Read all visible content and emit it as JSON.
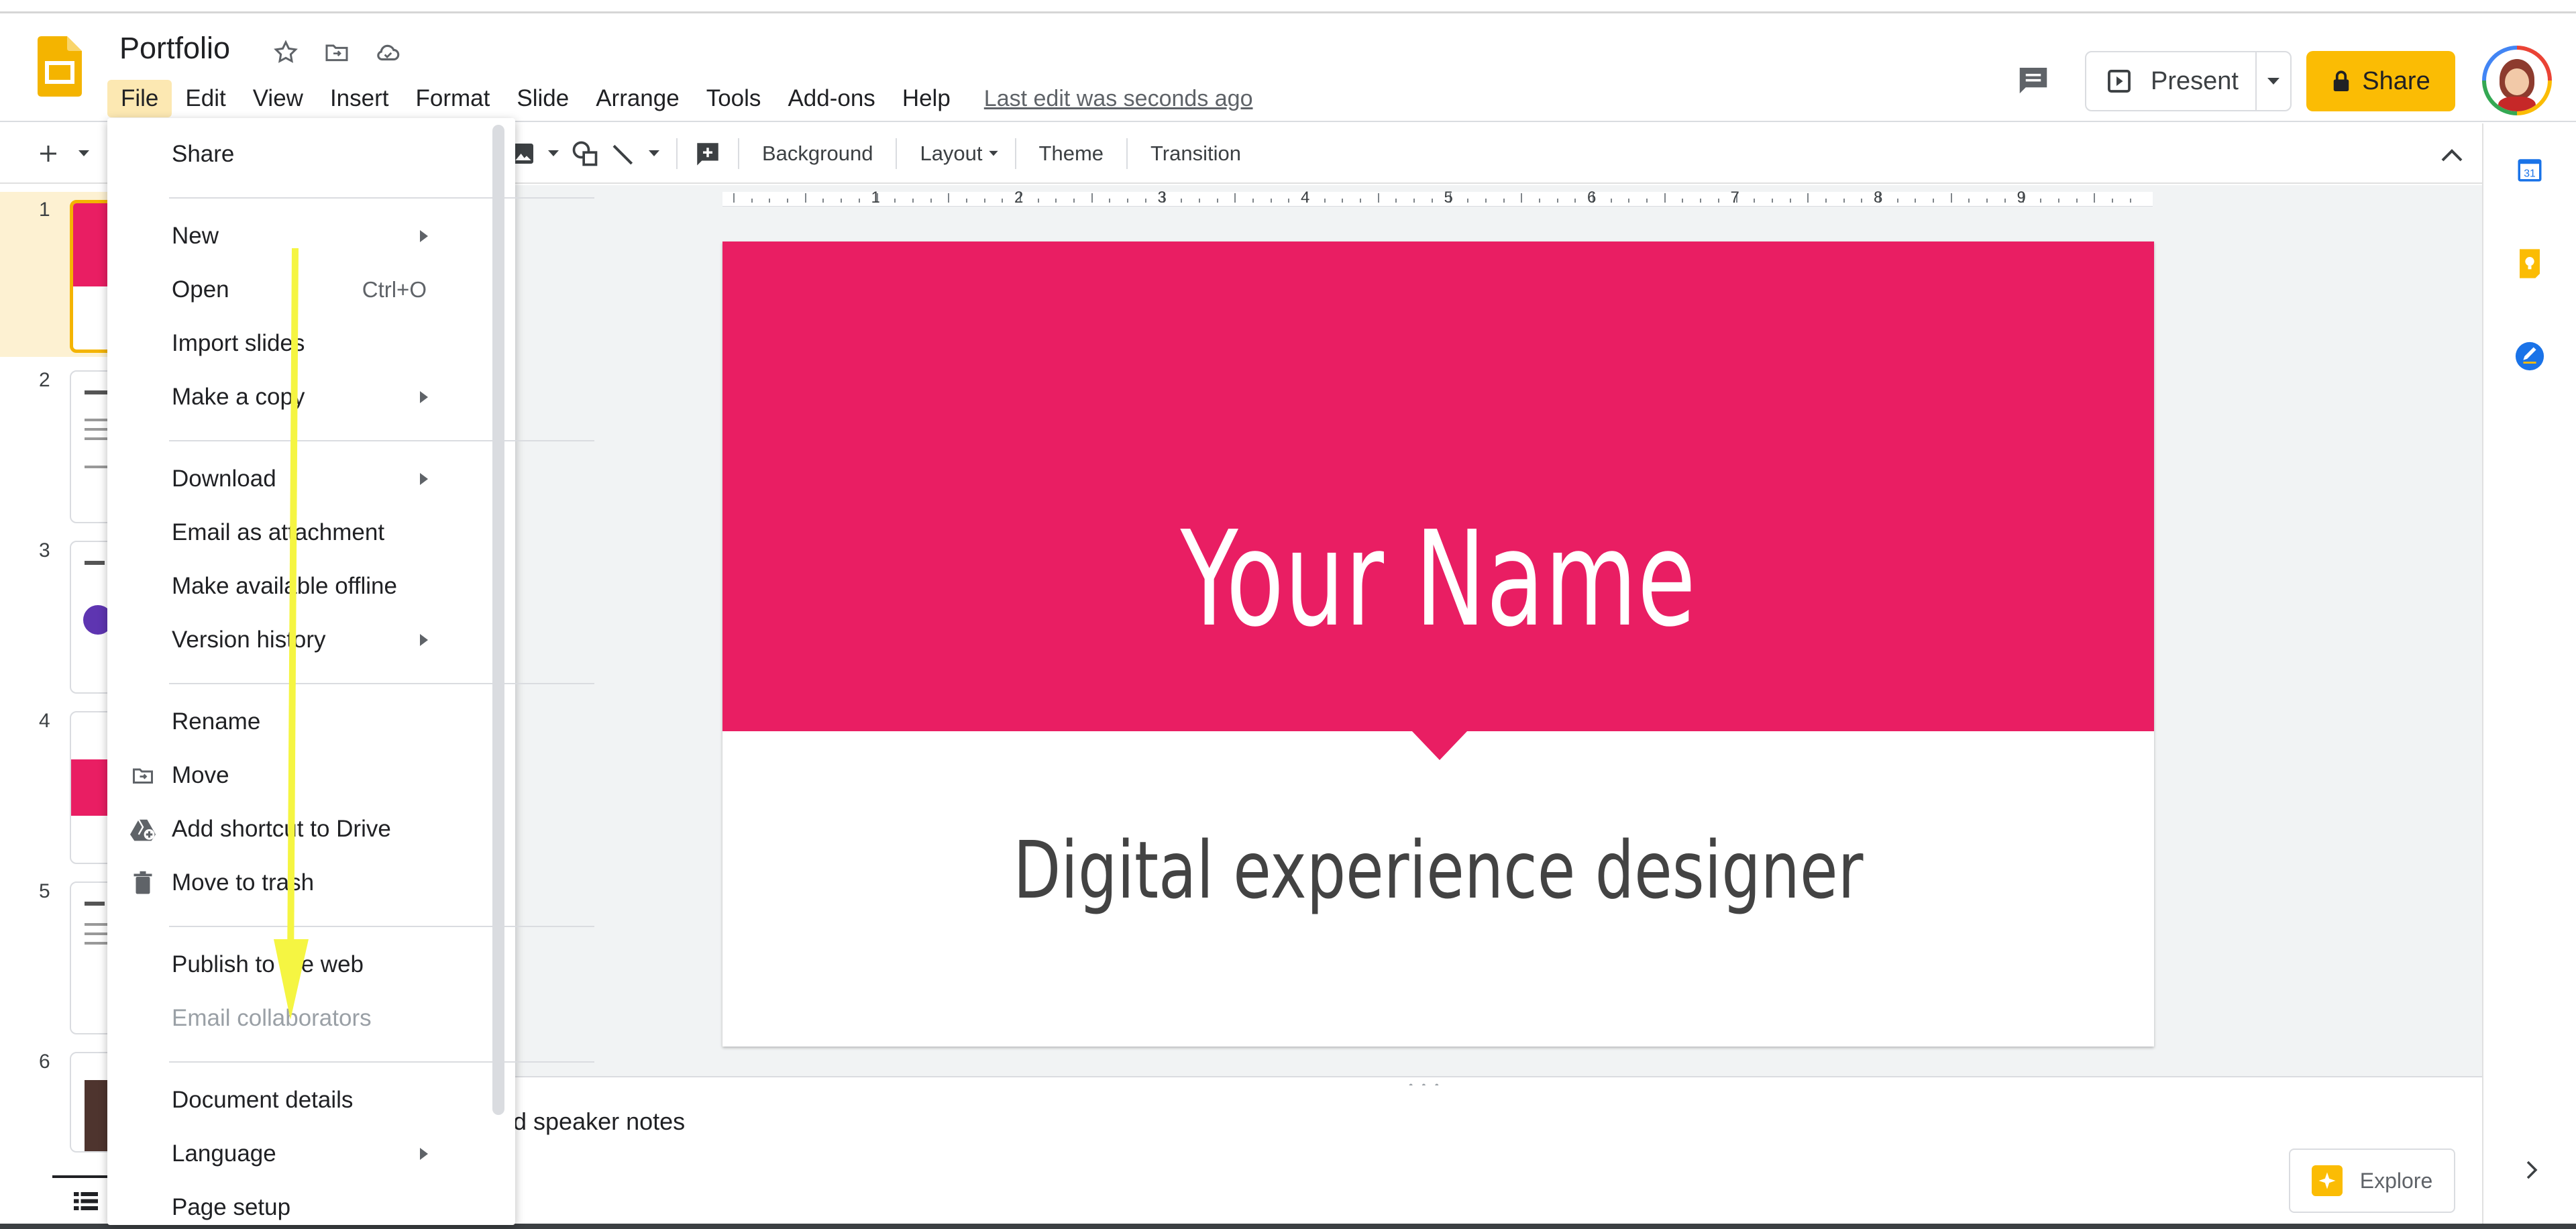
{
  "header": {
    "doc_title": "Portfolio",
    "menus": [
      "File",
      "Edit",
      "View",
      "Insert",
      "Format",
      "Slide",
      "Arrange",
      "Tools",
      "Add-ons",
      "Help"
    ],
    "last_edit": "Last edit was seconds ago",
    "present_label": "Present",
    "share_label": "Share"
  },
  "toolbar": {
    "background_label": "Background",
    "layout_label": "Layout",
    "theme_label": "Theme",
    "transition_label": "Transition"
  },
  "filmstrip": {
    "slide_numbers": [
      "1",
      "2",
      "3",
      "4",
      "5",
      "6"
    ],
    "selected_slide": 1
  },
  "ruler": {
    "labels": [
      "1",
      "2",
      "3",
      "4",
      "5",
      "6",
      "7",
      "8",
      "9"
    ]
  },
  "slide": {
    "title": "Your Name",
    "subtitle": "Digital experience designer",
    "accent_color": "#e91e63"
  },
  "notes": {
    "placeholder_visible": "d speaker notes"
  },
  "explore": {
    "label": "Explore"
  },
  "file_menu": {
    "items": [
      {
        "label": "Share",
        "submenu": false,
        "icon": ""
      },
      {
        "label": "New",
        "submenu": true,
        "icon": ""
      },
      {
        "label": "Open",
        "shortcut": "Ctrl+O",
        "icon": ""
      },
      {
        "label": "Import slides",
        "icon": ""
      },
      {
        "label": "Make a copy",
        "submenu": true,
        "icon": ""
      },
      {
        "label": "Download",
        "submenu": true,
        "icon": ""
      },
      {
        "label": "Email as attachment",
        "icon": ""
      },
      {
        "label": "Make available offline",
        "icon": ""
      },
      {
        "label": "Version history",
        "submenu": true,
        "icon": ""
      },
      {
        "label": "Rename",
        "icon": ""
      },
      {
        "label": "Move",
        "icon": "move-folder-icon"
      },
      {
        "label": "Add shortcut to Drive",
        "icon": "drive-shortcut-icon"
      },
      {
        "label": "Move to trash",
        "icon": "trash-icon"
      },
      {
        "label": "Publish to the web",
        "icon": ""
      },
      {
        "label": "Email collaborators",
        "disabled": true,
        "icon": ""
      },
      {
        "label": "Document details",
        "icon": ""
      },
      {
        "label": "Language",
        "submenu": true,
        "icon": ""
      },
      {
        "label": "Page setup",
        "icon": ""
      }
    ]
  },
  "colors": {
    "brand_yellow": "#fbbc04",
    "slide_pink": "#e91e63",
    "annotation_arrow": "#f5f542"
  }
}
